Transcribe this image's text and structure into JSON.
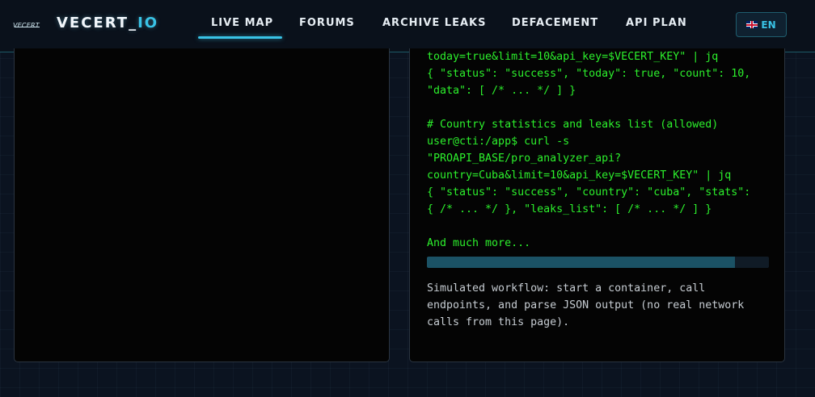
{
  "header": {
    "logo_small": "VECERT",
    "brand_main": "VECERT_",
    "brand_accent": "IO",
    "nav": [
      {
        "label": "LIVE MAP",
        "active": true
      },
      {
        "label": "FORUMS",
        "active": false
      },
      {
        "label": "ARCHIVE LEAKS",
        "active": false
      },
      {
        "label": "DEFACEMENT",
        "active": false
      },
      {
        "label": "API PLAN",
        "active": false
      }
    ],
    "language": {
      "label": "EN",
      "icon": "uk-flag-icon"
    }
  },
  "terminal": {
    "lines": [
      "today=true&limit=10&api_key=$VECERT_KEY\" | jq",
      "{ \"status\": \"success\", \"today\": true, \"count\": 10,",
      "\"data\": [ /* ... */ ] }",
      "",
      "# Country statistics and leaks list (allowed)",
      "user@cti:/app$ curl -s",
      "\"PROAPI_BASE/pro_analyzer_api?",
      "country=Cuba&limit=10&api_key=$VECERT_KEY\" | jq",
      "{ \"status\": \"success\", \"country\": \"cuba\", \"stats\":",
      "{ /* ... */ }, \"leaks_list\": [ /* ... */ ] }",
      "",
      "And much more..."
    ],
    "progress_percent": 90,
    "description": [
      "Simulated workflow: start a container, call",
      "endpoints, and parse JSON output (no real network",
      "calls from this page)."
    ]
  },
  "colors": {
    "accent": "#39c3e6",
    "terminal_text": "#2cf02c",
    "progress_fill": "#1b5265"
  }
}
